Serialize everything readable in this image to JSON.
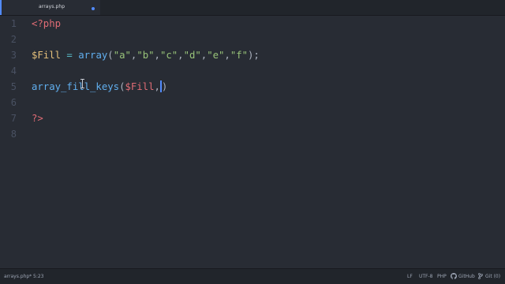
{
  "tabs": [
    {
      "title": "arrays.php",
      "modified": true
    }
  ],
  "editor": {
    "line_numbers": [
      "1",
      "2",
      "3",
      "4",
      "5",
      "6",
      "7",
      "8"
    ],
    "lines": {
      "l1": {
        "open_tag": "<?php"
      },
      "l3": {
        "var": "$Fill",
        "assign": " = ",
        "fn": "array",
        "open": "(",
        "args": [
          "\"a\"",
          "\"b\"",
          "\"c\"",
          "\"d\"",
          "\"e\"",
          "\"f\""
        ],
        "comma": ",",
        "close": ");"
      },
      "l5": {
        "fn": "array_fill_keys",
        "open": "(",
        "var": "$Fill",
        "comma": ",",
        "close": ")"
      },
      "l7": {
        "close_tag": "?>"
      }
    },
    "accent_color": "#528bff"
  },
  "statusbar": {
    "file": "arrays.php*",
    "cursor_position": "5:23",
    "line_ending": "LF",
    "encoding": "UTF-8",
    "grammar": "PHP",
    "github": "GitHub",
    "git": "Git (0)"
  }
}
